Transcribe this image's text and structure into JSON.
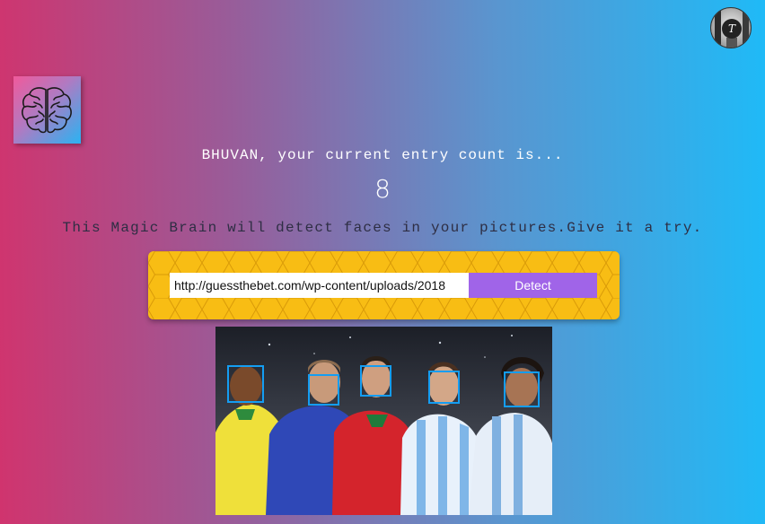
{
  "profile": {
    "avatar_icon": "user-avatar-icon",
    "avatar_initial": "T"
  },
  "logo": {
    "icon": "brain-icon",
    "gradient": [
      "#f05a9b",
      "#2ab3f2"
    ]
  },
  "entry": {
    "message": "BHUVAN, your current entry count is...",
    "count": "8"
  },
  "description": "This Magic Brain will detect faces in your pictures.Give it a try.",
  "form": {
    "url_value": "http://guessthebet.com/wp-content/uploads/2018",
    "detect_label": "Detect"
  },
  "colors": {
    "background_left": "#d0346e",
    "background_right": "#1fbaf7",
    "panel": "#f8bd14",
    "button": "#a064e8",
    "face_box": "#149df2"
  },
  "result": {
    "face_count": 5
  }
}
